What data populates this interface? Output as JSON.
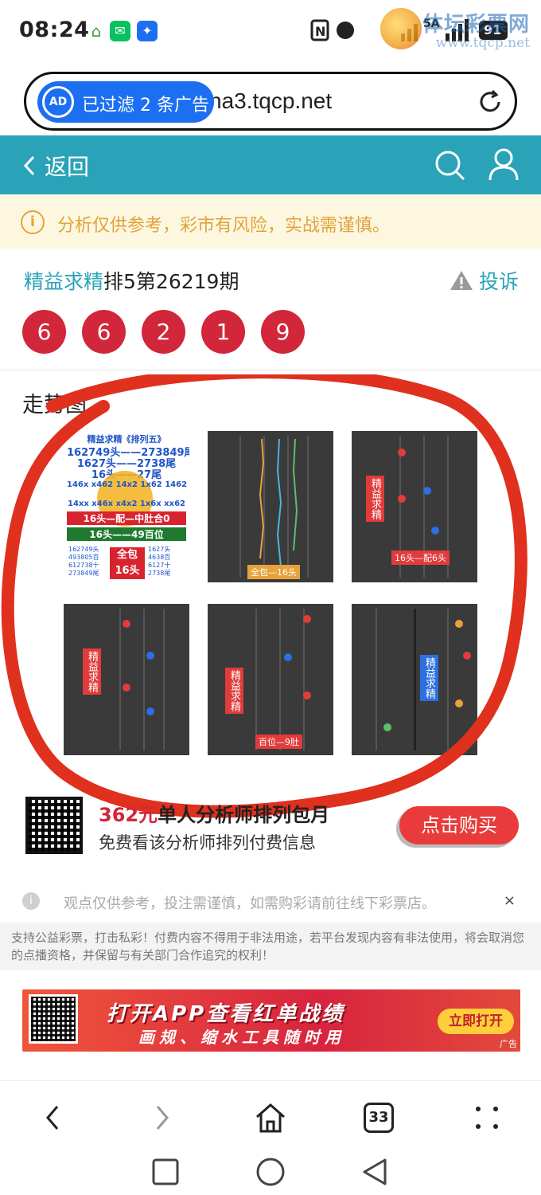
{
  "status": {
    "time": "08:24",
    "battery": "91",
    "network": "5A"
  },
  "watermark": {
    "text": "体坛彩票网",
    "url": "www.tqcp.net"
  },
  "urlbar": {
    "url": "na3.tqcp.net",
    "ad_filter": "已过滤 2 条广告",
    "ad_badge": "AD"
  },
  "header": {
    "back_label": "返回"
  },
  "notice": {
    "text": "分析仅供参考，彩市有风险，实战需谨慎。"
  },
  "post": {
    "analyst": "精益求精",
    "issue": "排5第26219期",
    "complain_label": "投诉",
    "numbers": [
      "6",
      "6",
      "2",
      "1",
      "9"
    ]
  },
  "trend": {
    "title": "走势图",
    "thumb1": {
      "lines": [
        "精益求精《排列五》",
        "162749头——273849尾",
        "1627头——2738尾",
        "16头——27尾",
        "146x x462 14x2 1x62 1462",
        "14xx x46x x4x2 1x6x xx62",
        "16头—配—中肚合0",
        "16头——49百位",
        "全包 16头"
      ]
    },
    "thumb_labels": [
      "精益求精",
      "精益求精",
      "精益求精",
      "精益求精"
    ],
    "thumb_tags": [
      "16头—配6头",
      "全包—16头",
      "百位—9肚"
    ]
  },
  "purchase": {
    "price_prefix": "3",
    "price": "62元",
    "title": "单人分析师排列包月",
    "subtitle": "免费看该分析师排列付费信息",
    "button": "点击购买"
  },
  "tip": {
    "text": "观点仅供参考，投注需谨慎，如需购彩请前往线下彩票店。",
    "close": "×"
  },
  "legal": "支持公益彩票，打击私彩！付费内容不得用于非法用途，若平台发现内容有非法使用，将会取消您的点播资格，并保留与有关部门合作追究的权利！",
  "banner": {
    "line1": "打开APP查看红单战绩",
    "line2": "画规、缩水工具随时用",
    "button": "立即打开",
    "ad": "广告"
  },
  "nav": {
    "tabs_count": "33"
  },
  "colors": {
    "header": "#2aa3b9",
    "ball": "#d2263a",
    "scribble": "#e0301e"
  }
}
